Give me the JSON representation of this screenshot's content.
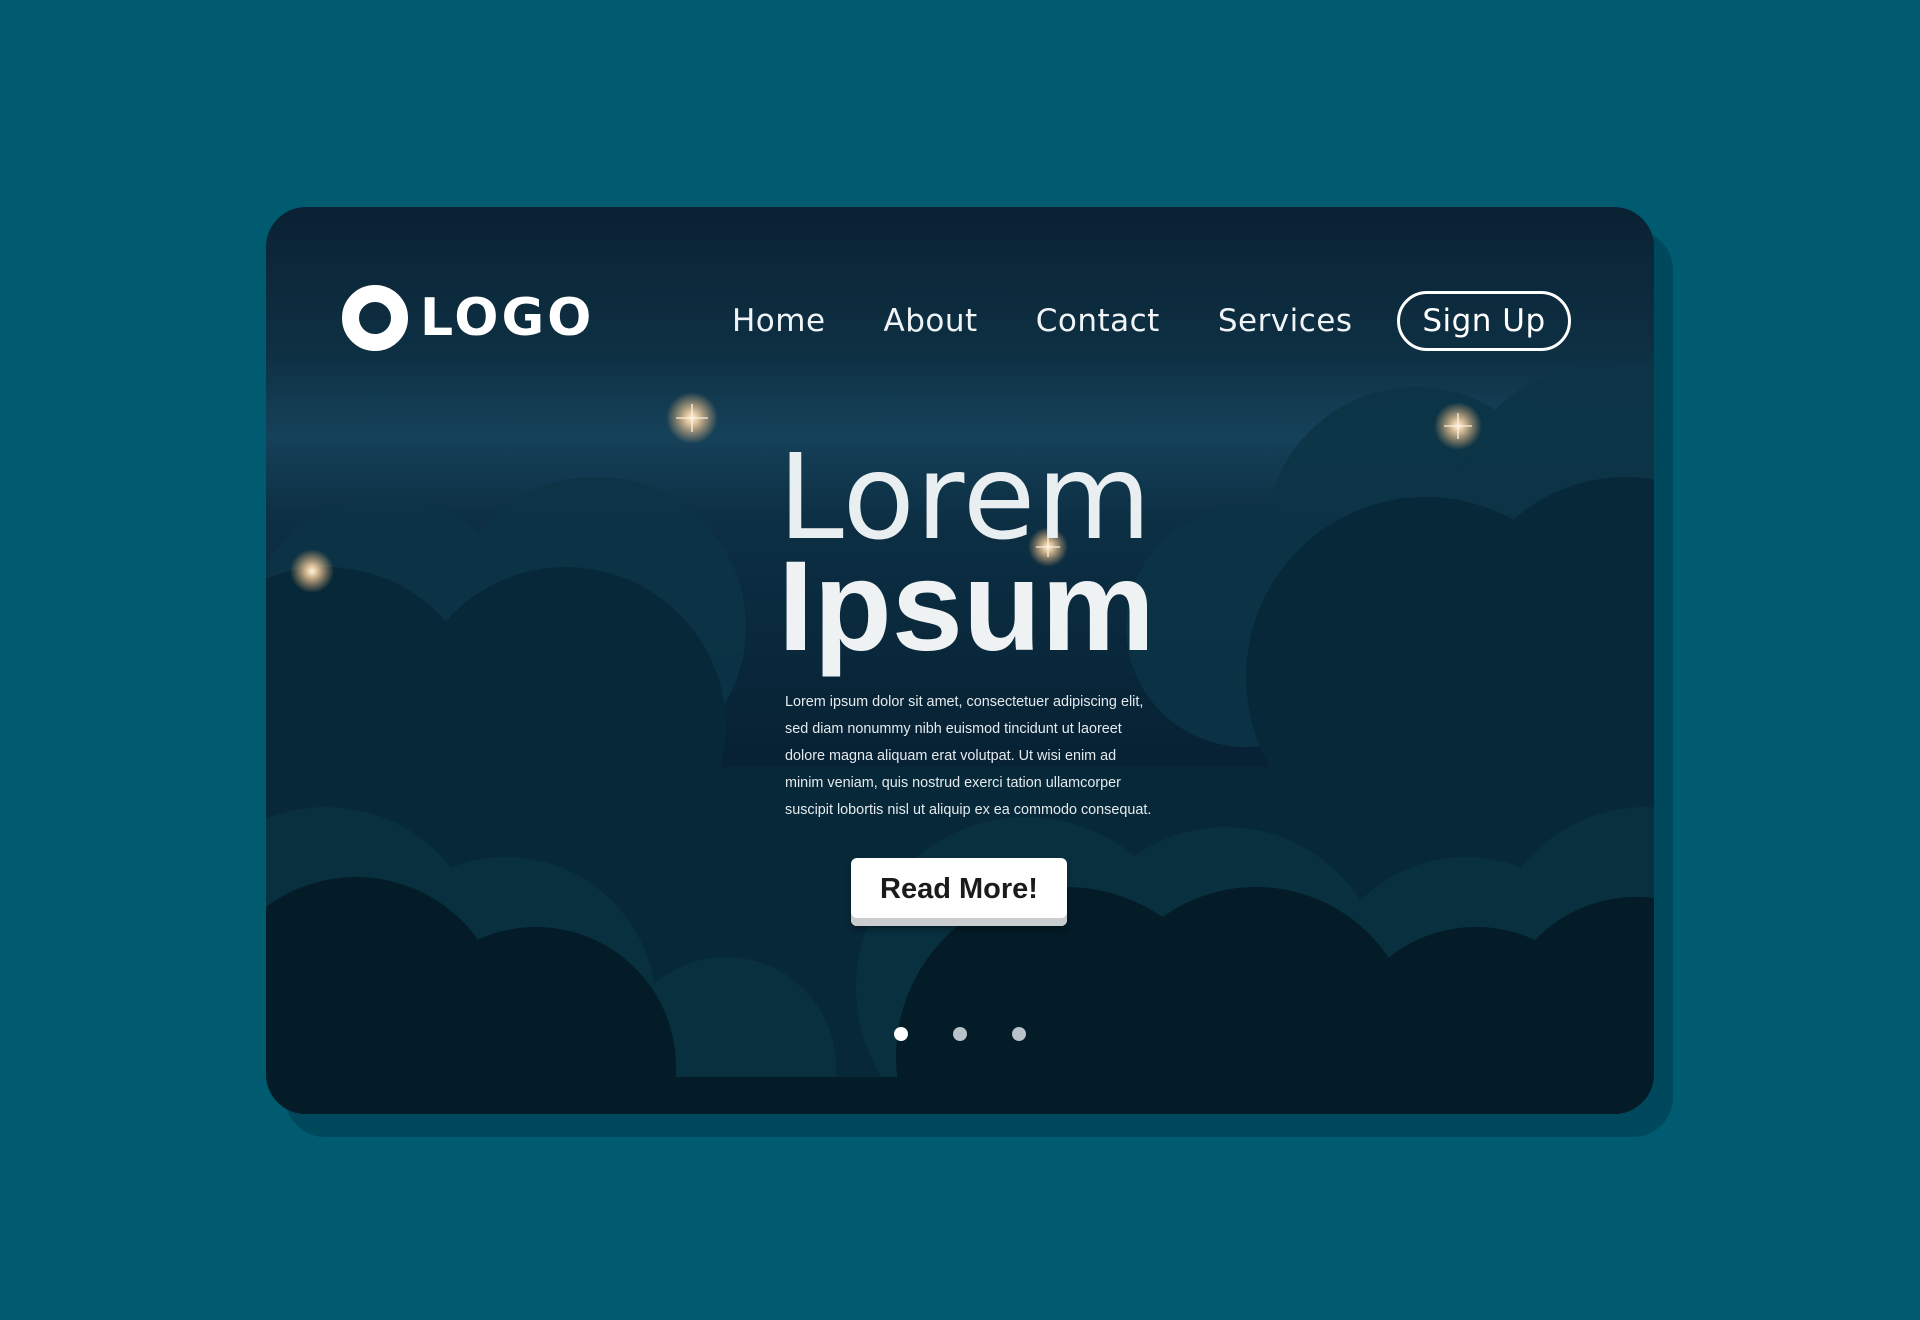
{
  "logo": {
    "text": "LOGO",
    "icon": "ring-logo-icon"
  },
  "nav": {
    "items": [
      {
        "label": "Home"
      },
      {
        "label": "About"
      },
      {
        "label": "Contact"
      },
      {
        "label": "Services"
      }
    ],
    "signup_label": "Sign Up"
  },
  "hero": {
    "title_light": "Lorem",
    "title_bold": "Ipsum",
    "body": "Lorem ipsum dolor sit amet, consectetuer adipiscing elit,\nsed diam nonummy nibh euismod tincidunt ut laoreet\ndolore magna aliquam erat volutpat. Ut wisi enim ad\nminim veniam, quis nostrud exerci tation ullamcorper\nsuscipit lobortis nisl ut aliquip ex ea commodo consequat.",
    "button_label": "Read More!"
  },
  "carousel": {
    "slide_count": 3,
    "active_index": 0
  },
  "colors": {
    "page_background": "#005a70",
    "card_shadow": "#00495d",
    "card_top": "#0f3549",
    "card_bottom": "#041a28",
    "cloud_light": "#0c3446",
    "cloud_dark": "#03202c",
    "star_glow": "#ffd9a8",
    "text_primary": "#ffffff"
  }
}
